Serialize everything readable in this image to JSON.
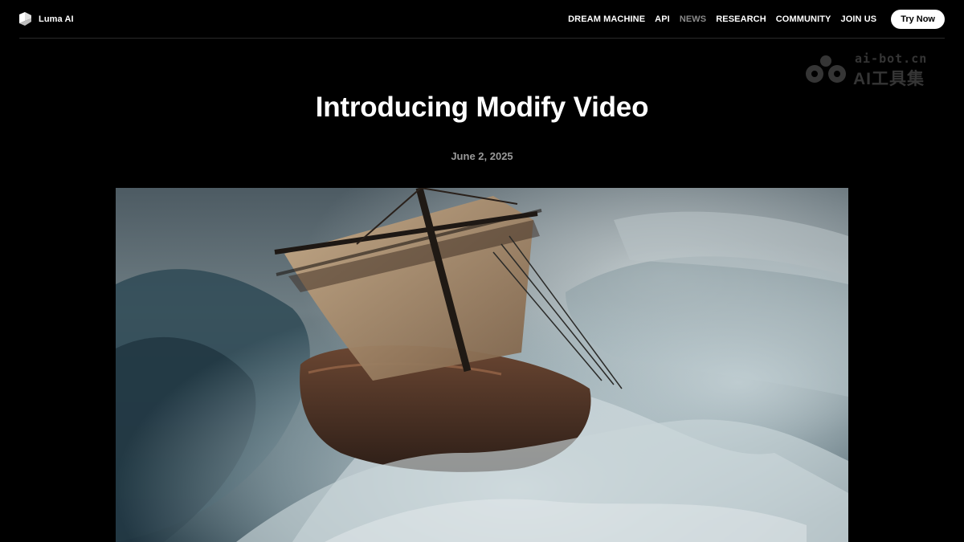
{
  "header": {
    "brand_name": "Luma AI",
    "brand_icon": "luma-logo-icon",
    "nav": [
      {
        "label": "DREAM MACHINE",
        "active": false
      },
      {
        "label": "API",
        "active": false
      },
      {
        "label": "NEWS",
        "active": true
      },
      {
        "label": "RESEARCH",
        "active": false
      },
      {
        "label": "COMMUNITY",
        "active": false
      },
      {
        "label": "JOIN US",
        "active": false
      }
    ],
    "cta_label": "Try Now"
  },
  "watermark": {
    "domain": "ai-bot.cn",
    "label": "AI工具集",
    "icon": "ai-bot-logo-icon"
  },
  "article": {
    "title": "Introducing Modify Video",
    "date": "June 2, 2025",
    "hero_subject": "hero-image"
  },
  "colors": {
    "background": "#000000",
    "text": "#ffffff",
    "muted": "#9a9a9a",
    "nav_active": "#8a8a8a",
    "divider": "#2a2a2a"
  }
}
